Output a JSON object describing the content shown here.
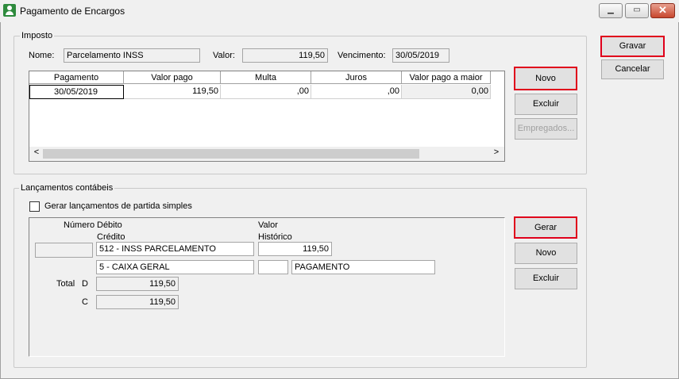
{
  "window": {
    "title": "Pagamento de Encargos",
    "min": "▁",
    "max": "▭",
    "close": "✕"
  },
  "imposto": {
    "legend": "Imposto",
    "nome_label": "Nome:",
    "nome": "Parcelamento INSS",
    "valor_label": "Valor:",
    "valor": "119,50",
    "vencimento_label": "Vencimento:",
    "vencimento": "30/05/2019",
    "columns": [
      "Pagamento",
      "Valor pago",
      "Multa",
      "Juros",
      "Valor pago a maior"
    ],
    "rows": [
      {
        "pagamento": "30/05/2019",
        "valor_pago": "119,50",
        "multa": ",00",
        "juros": ",00",
        "valor_maior": "0,00"
      }
    ],
    "scroll_left": "<",
    "scroll_right": ">"
  },
  "buttons": {
    "gravar": "Gravar",
    "cancelar": "Cancelar",
    "novo": "Novo",
    "excluir": "Excluir",
    "empregados": "Empregados...",
    "gerar": "Gerar",
    "novo2": "Novo",
    "excluir2": "Excluir"
  },
  "lancamentos": {
    "legend": "Lançamentos contábeis",
    "checkbox_label": "Gerar lançamentos de partida simples",
    "checkbox_checked": false,
    "header_numero": "Número",
    "header_debito": "Débito",
    "header_credito": "Crédito",
    "header_valor": "Valor",
    "header_historico": "Histórico",
    "numero": "",
    "debito": "512 - INSS PARCELAMENTO",
    "credito": "5 - CAIXA GERAL",
    "valor": "119,50",
    "historico_codigo": "",
    "historico": "PAGAMENTO",
    "total_label": "Total",
    "d_label": "D",
    "c_label": "C",
    "total_d": "119,50",
    "total_c": "119,50"
  },
  "colors": {
    "highlight": "#e0001b",
    "icon": "#2e8b3d"
  },
  "icons": [
    "user-app-icon",
    "minimize-icon",
    "maximize-icon",
    "close-icon",
    "scroll-left-icon",
    "scroll-right-icon"
  ]
}
